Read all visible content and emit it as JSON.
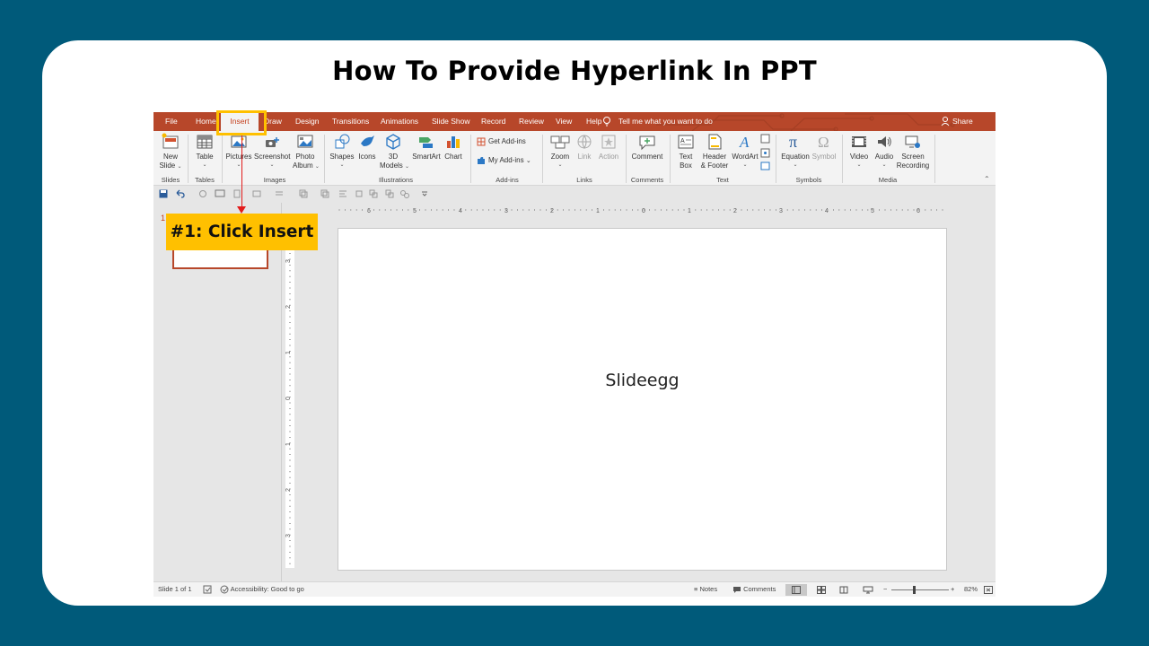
{
  "slide_title": "How To Provide Hyperlink In PPT",
  "tabs": [
    "File",
    "Home",
    "Insert",
    "Draw",
    "Design",
    "Transitions",
    "Animations",
    "Slide Show",
    "Record",
    "Review",
    "View",
    "Help"
  ],
  "active_tab": "Insert",
  "tell_me": "Tell me what you want to do",
  "share": "Share",
  "ribbon": {
    "new_slide": [
      "New",
      "Slide"
    ],
    "table": "Table",
    "pictures": "Pictures",
    "screenshot": "Screenshot",
    "photo_album": [
      "Photo",
      "Album"
    ],
    "shapes": "Shapes",
    "icons": "Icons",
    "models_3d": [
      "3D",
      "Models"
    ],
    "smartart": "SmartArt",
    "chart": "Chart",
    "get_addins": "Get Add-ins",
    "my_addins": "My Add-ins",
    "zoom": "Zoom",
    "link": "Link",
    "action": "Action",
    "comment": "Comment",
    "text_box": [
      "Text",
      "Box"
    ],
    "header_footer": [
      "Header",
      "& Footer"
    ],
    "wordart": "WordArt",
    "equation": "Equation",
    "symbol": "Symbol",
    "video": "Video",
    "audio": "Audio",
    "screen_recording": [
      "Screen",
      "Recording"
    ],
    "groups": [
      "Slides",
      "Tables",
      "Images",
      "Illustrations",
      "Add-ins",
      "Links",
      "Comments",
      "Text",
      "Symbols",
      "Media"
    ]
  },
  "thumbnail_number": "1",
  "ruler_h": [
    "6",
    "5",
    "4",
    "3",
    "2",
    "1",
    "0",
    "1",
    "2",
    "3",
    "4",
    "5",
    "6"
  ],
  "ruler_v": [
    "3",
    "2",
    "1",
    "0",
    "1",
    "2",
    "3"
  ],
  "slide_body_text": "Slideegg",
  "status": {
    "slide_count": "Slide 1 of 1",
    "accessibility": "Accessibility: Good to go",
    "notes": "Notes",
    "comments": "Comments",
    "zoom": "82%"
  },
  "callout_text": "#1: Click Insert",
  "colors": {
    "background": "#005a7a",
    "tab_bar": "#b7472a",
    "callout": "#ffc000",
    "arrow": "#e31c1c"
  }
}
